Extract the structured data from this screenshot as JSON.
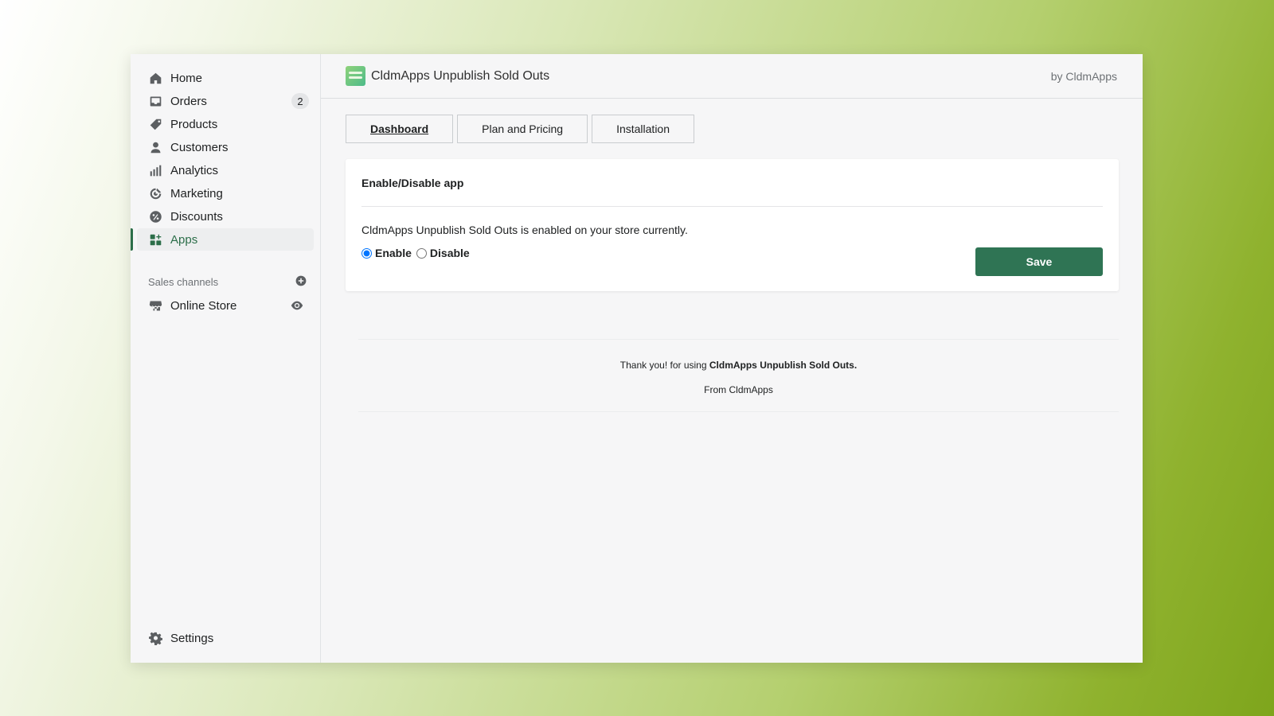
{
  "sidebar": {
    "items": [
      {
        "label": "Home",
        "icon": "home-icon"
      },
      {
        "label": "Orders",
        "icon": "inbox-icon",
        "badge": "2"
      },
      {
        "label": "Products",
        "icon": "tag-icon"
      },
      {
        "label": "Customers",
        "icon": "person-icon"
      },
      {
        "label": "Analytics",
        "icon": "bar-chart-icon"
      },
      {
        "label": "Marketing",
        "icon": "target-icon"
      },
      {
        "label": "Discounts",
        "icon": "discount-icon"
      },
      {
        "label": "Apps",
        "icon": "apps-icon",
        "active": true
      }
    ],
    "sales_channels_label": "Sales channels",
    "online_store_label": "Online Store",
    "settings_label": "Settings"
  },
  "header": {
    "app_title": "CldmApps Unpublish Sold Outs",
    "by_label": "by CldmApps"
  },
  "tabs": [
    {
      "label": "Dashboard",
      "active": true
    },
    {
      "label": "Plan and Pricing"
    },
    {
      "label": "Installation"
    }
  ],
  "card": {
    "title": "Enable/Disable app",
    "status_text": "CldmApps Unpublish Sold Outs is enabled on your store currently.",
    "enable_label": "Enable",
    "disable_label": "Disable",
    "selected": "Enable",
    "save_label": "Save"
  },
  "footer": {
    "thanks_prefix": "Thank you! for using ",
    "thanks_app": "CldmApps Unpublish Sold Outs.",
    "from_label": "From CldmApps"
  },
  "colors": {
    "accent_green": "#2f7454",
    "active_nav": "#2c6e49"
  }
}
